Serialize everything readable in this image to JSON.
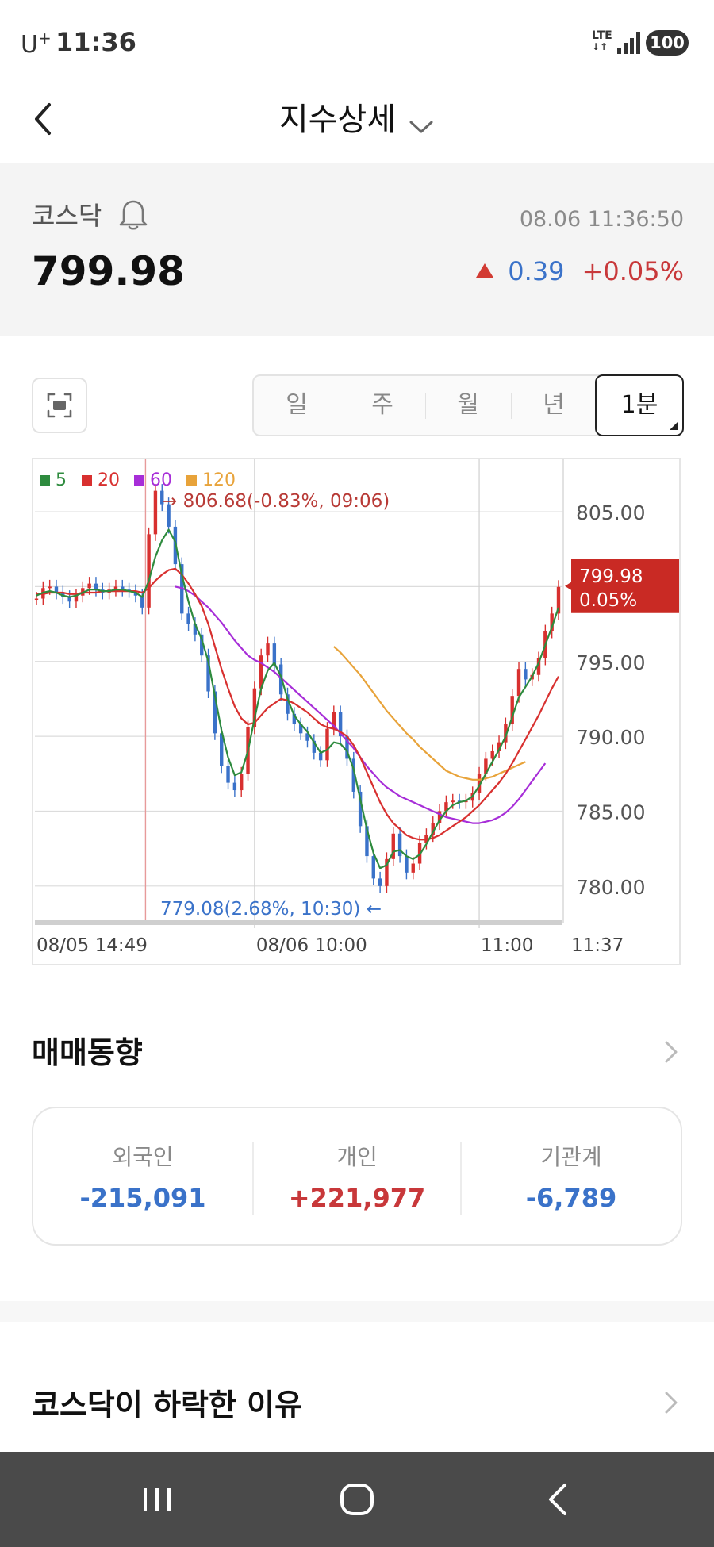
{
  "status_bar": {
    "carrier": "U",
    "carrier_sup": "+",
    "time": "11:36",
    "network": "LTE",
    "battery": "100"
  },
  "header": {
    "title": "지수상세"
  },
  "summary": {
    "name": "코스닥",
    "timestamp": "08.06 11:36:50",
    "price": "799.98",
    "change_abs": "0.39",
    "change_pct": "+0.05%"
  },
  "periods": [
    {
      "label": "일",
      "active": false
    },
    {
      "label": "주",
      "active": false
    },
    {
      "label": "월",
      "active": false
    },
    {
      "label": "년",
      "active": false
    },
    {
      "label": "1분",
      "active": true
    }
  ],
  "chart_data": {
    "type": "line",
    "legend": [
      {
        "name": "5",
        "color": "#2e8b3e"
      },
      {
        "name": "20",
        "color": "#d8302f"
      },
      {
        "name": "60",
        "color": "#a72ed8"
      },
      {
        "name": "120",
        "color": "#e8a33a"
      }
    ],
    "y_ticks": [
      "805.00",
      "795.00",
      "790.00",
      "785.00",
      "780.00"
    ],
    "ylim": [
      777.5,
      808.5
    ],
    "x_ticks": [
      "08/05 14:49",
      "08/06 10:00",
      "11:00",
      "11:37"
    ],
    "high_label": "806.68(-0.83%, 09:06)",
    "low_label": "779.08(2.68%, 10:30)",
    "current_price_label": "799.98",
    "current_pct_label": "0.05%",
    "price_series": [
      799.2,
      799.9,
      800.0,
      799.6,
      799.3,
      799.0,
      799.4,
      799.9,
      800.2,
      799.8,
      799.6,
      799.8,
      800.0,
      799.8,
      799.7,
      799.4,
      798.6,
      803.5,
      806.4,
      805.5,
      804.0,
      801.5,
      798.2,
      797.5,
      796.8,
      795.4,
      793.0,
      790.2,
      788.0,
      786.9,
      786.4,
      787.5,
      790.6,
      793.2,
      795.4,
      796.2,
      794.8,
      792.8,
      791.5,
      790.8,
      790.2,
      789.7,
      788.9,
      788.4,
      790.5,
      791.6,
      790.0,
      788.5,
      786.3,
      784.0,
      782.0,
      780.5,
      780.0,
      781.8,
      783.5,
      782.0,
      780.9,
      781.5,
      782.9,
      783.4,
      784.2,
      785.0,
      785.6,
      785.7,
      785.6,
      785.7,
      786.2,
      787.5,
      788.5,
      789.0,
      789.6,
      790.8,
      792.7,
      794.5,
      793.8,
      794.1,
      795.2,
      797.0,
      798.2,
      799.98
    ],
    "ma5": [
      799.4,
      799.6,
      799.7,
      799.6,
      799.4,
      799.3,
      799.4,
      799.6,
      799.8,
      799.8,
      799.7,
      799.7,
      799.8,
      799.8,
      799.7,
      799.6,
      799.3,
      800.4,
      802.0,
      803.1,
      803.8,
      803.0,
      800.8,
      799.0,
      797.5,
      796.5,
      795.0,
      792.7,
      790.4,
      788.6,
      787.4,
      787.6,
      789.0,
      791.2,
      793.2,
      794.4,
      794.9,
      794.0,
      792.5,
      791.4,
      790.8,
      790.3,
      789.6,
      788.9,
      789.1,
      789.6,
      789.5,
      789.0,
      787.8,
      785.8,
      783.8,
      782.2,
      781.2,
      781.4,
      782.3,
      782.4,
      782.0,
      781.8,
      782.1,
      782.8,
      783.6,
      784.4,
      785.0,
      785.4,
      785.6,
      785.7,
      786.0,
      786.7,
      787.5,
      788.3,
      789.1,
      790.0,
      791.3,
      792.6,
      793.3,
      794.0,
      794.9,
      796.1,
      797.3,
      798.6
    ],
    "ma20": [
      799.5,
      799.5,
      799.6,
      799.6,
      799.6,
      799.5,
      799.5,
      799.6,
      799.6,
      799.6,
      799.7,
      799.7,
      799.7,
      799.7,
      799.7,
      799.7,
      799.6,
      799.9,
      800.4,
      800.8,
      801.1,
      801.2,
      800.8,
      800.2,
      799.5,
      798.7,
      797.5,
      796.0,
      794.5,
      793.2,
      792.0,
      791.2,
      790.8,
      790.9,
      791.4,
      791.9,
      792.2,
      792.5,
      792.4,
      792.2,
      791.9,
      791.6,
      791.2,
      790.8,
      790.6,
      790.5,
      790.3,
      790.0,
      789.4,
      788.6,
      787.6,
      786.6,
      785.6,
      784.8,
      784.2,
      783.8,
      783.4,
      783.2,
      783.1,
      783.1,
      783.2,
      783.4,
      783.7,
      784.0,
      784.3,
      784.6,
      785.0,
      785.4,
      785.9,
      786.4,
      786.9,
      787.5,
      788.2,
      789.0,
      789.8,
      790.6,
      791.4,
      792.3,
      793.2,
      794.0
    ],
    "ma60": [
      null,
      null,
      null,
      null,
      null,
      null,
      null,
      null,
      null,
      null,
      null,
      null,
      null,
      null,
      null,
      null,
      null,
      null,
      null,
      null,
      null,
      800.0,
      799.9,
      799.7,
      799.4,
      799.0,
      798.6,
      798.1,
      797.6,
      797.0,
      796.4,
      795.9,
      795.4,
      795.1,
      794.9,
      794.6,
      794.3,
      793.9,
      793.5,
      793.1,
      792.7,
      792.3,
      791.9,
      791.5,
      791.1,
      790.7,
      790.2,
      789.7,
      789.2,
      788.6,
      788.0,
      787.5,
      787.0,
      786.6,
      786.3,
      786.0,
      785.8,
      785.6,
      785.4,
      785.2,
      785.0,
      784.8,
      784.6,
      784.5,
      784.4,
      784.3,
      784.2,
      784.2,
      784.3,
      784.4,
      784.6,
      784.9,
      785.3,
      785.8,
      786.4,
      787.0,
      787.6,
      788.2,
      null,
      null
    ],
    "ma120": [
      null,
      null,
      null,
      null,
      null,
      null,
      null,
      null,
      null,
      null,
      null,
      null,
      null,
      null,
      null,
      null,
      null,
      null,
      null,
      null,
      null,
      null,
      null,
      null,
      null,
      null,
      null,
      null,
      null,
      null,
      null,
      null,
      null,
      null,
      null,
      null,
      null,
      null,
      null,
      null,
      null,
      null,
      null,
      null,
      null,
      796.0,
      795.6,
      795.1,
      794.6,
      794.1,
      793.5,
      792.9,
      792.3,
      791.7,
      791.2,
      790.7,
      790.2,
      789.8,
      789.3,
      788.9,
      788.5,
      788.1,
      787.7,
      787.5,
      787.3,
      787.2,
      787.1,
      787.1,
      787.2,
      787.3,
      787.5,
      787.7,
      787.9,
      788.1,
      788.3,
      null,
      null,
      null,
      null,
      null
    ]
  },
  "trend": {
    "title": "매매동향",
    "items": [
      {
        "label": "외국인",
        "value": "-215,091",
        "color": "#3a72c9"
      },
      {
        "label": "개인",
        "value": "+221,977",
        "color": "#c8383a"
      },
      {
        "label": "기관계",
        "value": "-6,789",
        "color": "#3a72c9"
      }
    ]
  },
  "reason": {
    "title": "코스닥이 하락한 이유"
  },
  "colors": {
    "up": "#c8383a",
    "down": "#3a72c9",
    "price_badge": "#c92a24"
  },
  "icons": [
    "back-arrow-icon",
    "chevron-down-icon",
    "bell-icon",
    "capture-icon",
    "chevron-right-icon",
    "recent-apps-icon",
    "home-icon",
    "nav-back-icon"
  ]
}
